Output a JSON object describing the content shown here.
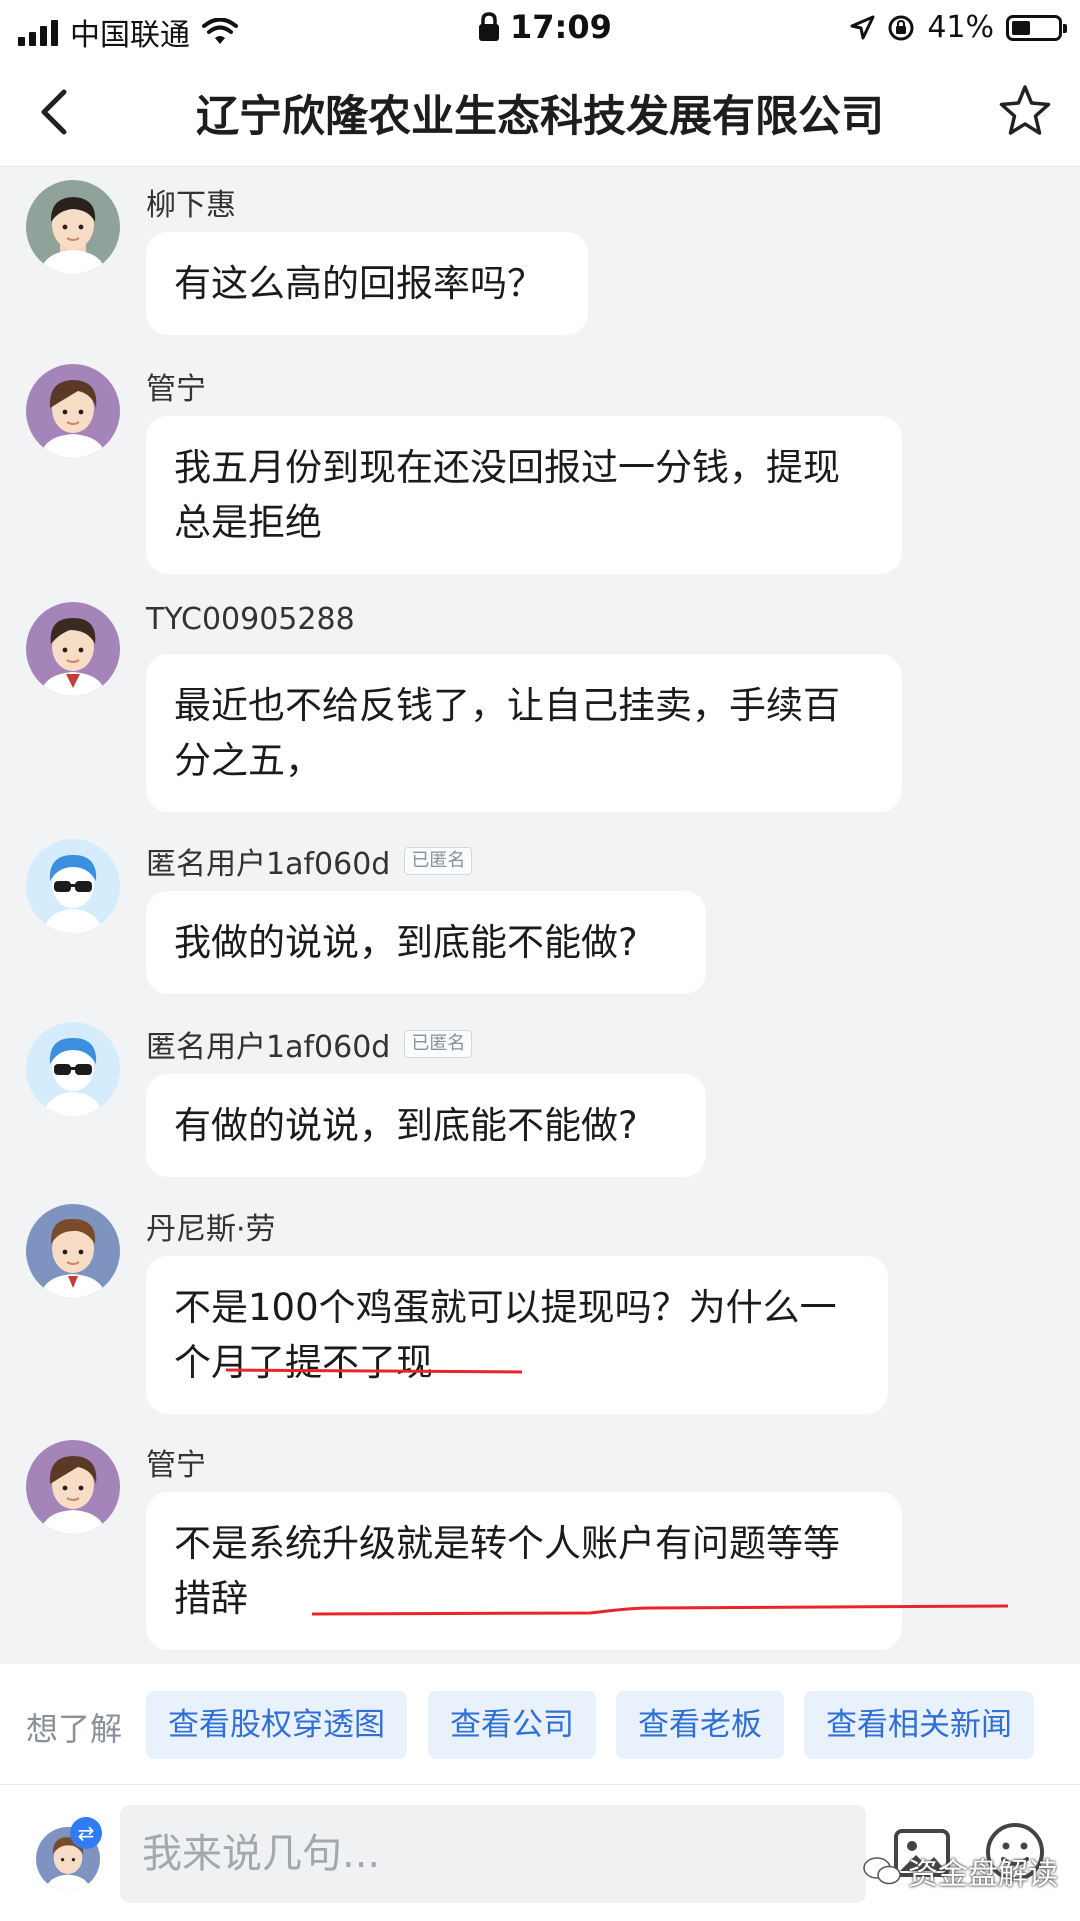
{
  "status_bar": {
    "carrier": "中国联通",
    "time": "17:09",
    "battery": "41%",
    "battery_level": 0.41,
    "icons": [
      "signal-icon",
      "wifi-icon",
      "lock-icon",
      "location-icon",
      "rotation-lock-icon",
      "battery-icon"
    ]
  },
  "header": {
    "title": "辽宁欣隆农业生态科技发展有限公司",
    "back_icon": "back-arrow-icon",
    "favorite_icon": "star-icon"
  },
  "comments": [
    {
      "user": "柳下惠",
      "text": "有这么高的回报率吗？",
      "anonymous": false,
      "avatar_color": "#8fa39a"
    },
    {
      "user": "管宁",
      "text": "我五月份到现在还没回报过一分钱，提现总是拒绝",
      "anonymous": false,
      "avatar_color": "#a585b9",
      "underlined": true
    },
    {
      "user": "TYC00905288",
      "text": "最近也不给反钱了，让自己挂卖，手续百分之五，",
      "anonymous": false,
      "avatar_color": "#a585b9"
    },
    {
      "user": "匿名用户1af060d",
      "badge": "已匿名",
      "text": "我做的说说，到底能不能做?",
      "anonymous": true,
      "avatar_color": "#d4ecfb"
    },
    {
      "user": "匿名用户1af060d",
      "badge": "已匿名",
      "text": "有做的说说，到底能不能做?",
      "anonymous": true,
      "avatar_color": "#d4ecfb"
    },
    {
      "user": "丹尼斯·劳",
      "text": "不是100个鸡蛋就可以提现吗？为什么一个月了提不了现",
      "anonymous": false,
      "avatar_color": "#7e93bf",
      "underlined": true
    },
    {
      "user": "管宁",
      "text": "不是系统升级就是转个人账户有问题等等措辞",
      "anonymous": false,
      "avatar_color": "#a585b9",
      "underlined": true
    }
  ],
  "suggestions": {
    "label": "想了解",
    "items": [
      "查看股权穿透图",
      "查看公司",
      "查看老板",
      "查看相关新闻"
    ]
  },
  "input_bar": {
    "placeholder": "我来说几句...",
    "image_icon": "image-icon",
    "emoji_icon": "emoji-icon",
    "switch_icon": "swap-icon"
  },
  "watermark": "资金盘解读",
  "colors": {
    "accent": "#2f6fd6",
    "chip_bg": "#e8f1fc",
    "underline": "#e8262a",
    "page_bg": "#f2f3f5"
  }
}
